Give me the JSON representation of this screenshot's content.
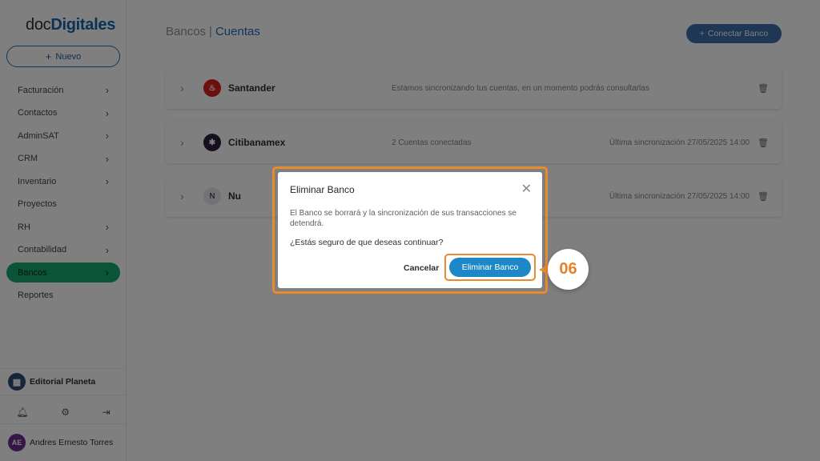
{
  "sidebar": {
    "logo_part1": "doc",
    "logo_part2": "Digitales",
    "new_button": "Nuevo",
    "items": [
      {
        "label": "Facturación",
        "has_chevron": true
      },
      {
        "label": "Contactos",
        "has_chevron": true
      },
      {
        "label": "AdminSAT",
        "has_chevron": true
      },
      {
        "label": "CRM",
        "has_chevron": true
      },
      {
        "label": "Inventario",
        "has_chevron": true
      },
      {
        "label": "Proyectos",
        "has_chevron": false
      },
      {
        "label": "RH",
        "has_chevron": true
      },
      {
        "label": "Contabilidad",
        "has_chevron": true
      },
      {
        "label": "Bancos",
        "has_chevron": true,
        "active": true
      },
      {
        "label": "Reportes",
        "has_chevron": false
      }
    ],
    "company": "Editorial Planeta",
    "user_initials": "AE",
    "user_name": "Andres Ernesto Torres"
  },
  "header": {
    "crumb1": "Bancos",
    "crumb2": "Cuentas",
    "connect_button": "Conectar Banco"
  },
  "banks": [
    {
      "name": "Santander",
      "status": "Estamos sincronizando tus cuentas, en un momento podrás consultarlas",
      "sync": "",
      "logo_color": "#d8201d",
      "logo_text": ""
    },
    {
      "name": "Citibanamex",
      "status": "2 Cuentas conectadas",
      "sync": "Última sincronización 27/05/2025 14:00",
      "logo_color": "#2b1f3e",
      "logo_text": ""
    },
    {
      "name": "Nu",
      "status": "",
      "sync": "Última sincronización 27/05/2025 14:00",
      "logo_color": "#e6e4ee",
      "logo_text": "N"
    }
  ],
  "modal": {
    "title": "Eliminar Banco",
    "body": "El Banco se borrará y la sincronización de sus transacciones se detendrá.",
    "question": "¿Estás seguro de que deseas continuar?",
    "cancel": "Cancelar",
    "confirm": "Eliminar Banco"
  },
  "step_badge": "06",
  "colors": {
    "accent_blue": "#1e87c8",
    "active_green": "#17a870",
    "highlight_orange": "#e88a2e"
  }
}
